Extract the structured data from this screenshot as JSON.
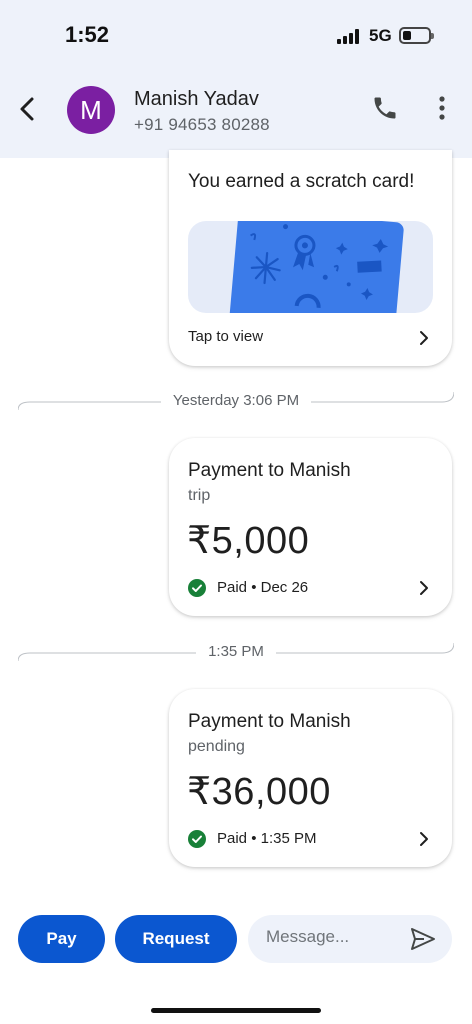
{
  "status": {
    "time": "1:52",
    "network": "5G"
  },
  "contact": {
    "initial": "M",
    "name": "Manish Yadav",
    "phone": "+91 94653 80288"
  },
  "scratch": {
    "title": "You earned a scratch card!",
    "action": "Tap to view"
  },
  "messages": [
    {
      "divider": "Yesterday 3:06 PM",
      "title": "Payment to Manish",
      "note": "trip",
      "amount": "₹5,000",
      "status": "Paid • Dec 26"
    },
    {
      "divider": "1:35 PM",
      "title": "Payment to Manish",
      "note": "pending",
      "amount": "₹36,000",
      "status": "Paid • 1:35 PM"
    }
  ],
  "bottom": {
    "pay_label": "Pay",
    "request_label": "Request",
    "message_placeholder": "Message..."
  },
  "colors": {
    "accent": "#0b57d0",
    "avatar": "#7b1fa2",
    "paid": "#188038",
    "header_bg": "#eef2fa",
    "scratch_card": "#3b7be9"
  }
}
